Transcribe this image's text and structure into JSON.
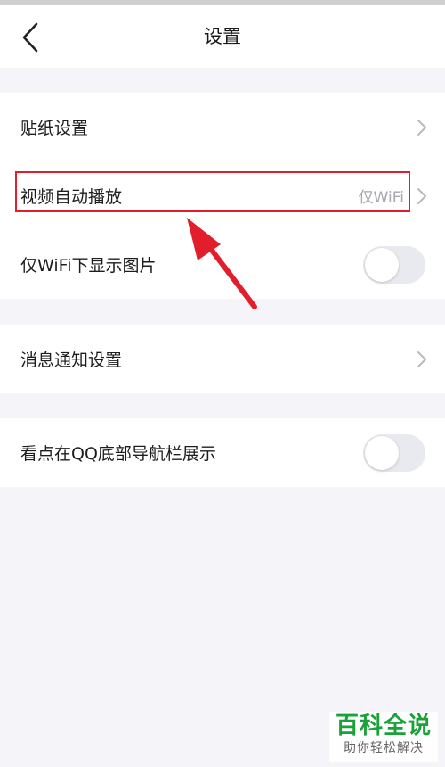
{
  "header": {
    "title": "设置",
    "back_icon": "chevron-left-icon"
  },
  "groups": [
    {
      "items": [
        {
          "label": "贴纸设置",
          "control": "chevron"
        },
        {
          "label": "视频自动播放",
          "value": "仅WiFi",
          "control": "chevron",
          "highlighted": true
        },
        {
          "label": "仅WiFi下显示图片",
          "control": "toggle",
          "on": false
        }
      ]
    },
    {
      "items": [
        {
          "label": "消息通知设置",
          "control": "chevron"
        }
      ]
    },
    {
      "items": [
        {
          "label": "看点在QQ底部导航栏展示",
          "control": "toggle",
          "on": false
        }
      ]
    }
  ],
  "annotation": {
    "color": "#e21d2c"
  },
  "watermark": {
    "title": "百科全说",
    "subtitle": "助你轻松解决"
  },
  "colors": {
    "background": "#f5f5f9",
    "toggle_off": "#e9e9f0",
    "watermark_green": "#1aa13a"
  }
}
